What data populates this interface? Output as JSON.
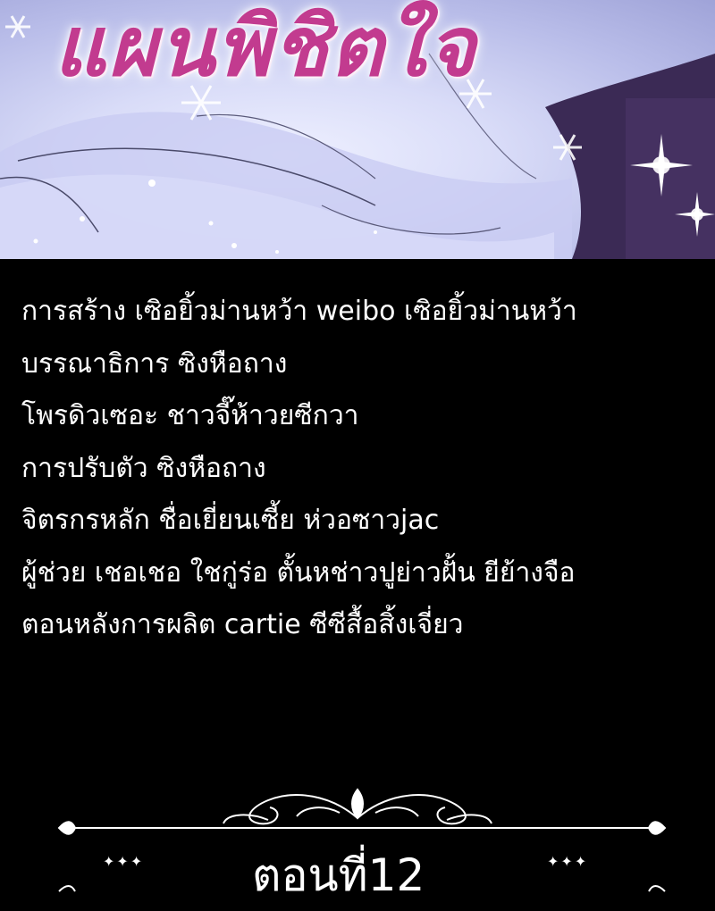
{
  "banner": {
    "title": "แผนพิชิตใจ"
  },
  "credits": [
    "การสร้าง เซิอยิ้วม่านหว้า  weibo เซิอยิ้วม่านหว้า",
    "บรรณาธิการ ซิงหือถาง",
    "โพรดิวเซอะ  ชาวจี๊ห้าวยซีกวา",
    "การปรับตัว ซิงหือถาง",
    "จิตรกรหลัก ชื่อเยี่ยนเซี้ย ห่วอซาวjac",
    "ผู้ช่วย เชอเชอ ใชกู่ร่อ ตั้นหช่าวปูย่าวฝั้น ยีย้างจือ",
    "ตอนหลังการผลิต cartie ซีซีสื้อสิ้งเจี่ยว"
  ],
  "chapter": {
    "label": "ตอนที่12"
  },
  "colors": {
    "background": "#000000",
    "text": "#ffffff",
    "title": "#c23b8f",
    "banner_tint": "#b9bde9"
  }
}
